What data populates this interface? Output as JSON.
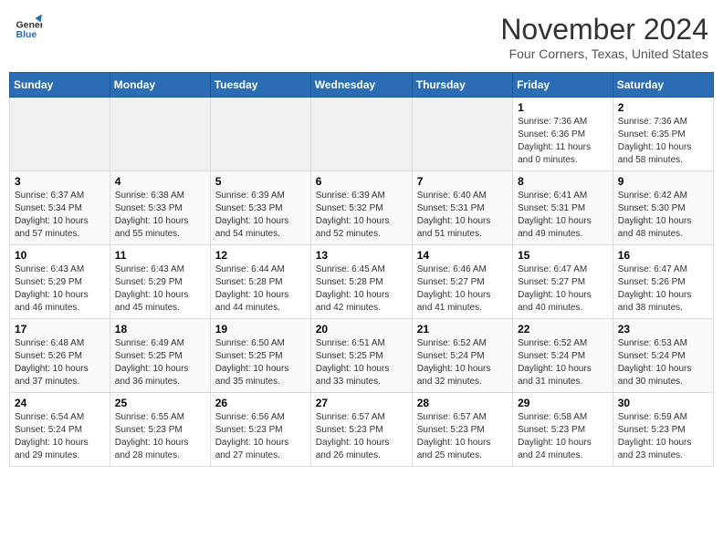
{
  "header": {
    "logo_general": "General",
    "logo_blue": "Blue",
    "month": "November 2024",
    "location": "Four Corners, Texas, United States"
  },
  "weekdays": [
    "Sunday",
    "Monday",
    "Tuesday",
    "Wednesday",
    "Thursday",
    "Friday",
    "Saturday"
  ],
  "weeks": [
    [
      {
        "day": "",
        "info": ""
      },
      {
        "day": "",
        "info": ""
      },
      {
        "day": "",
        "info": ""
      },
      {
        "day": "",
        "info": ""
      },
      {
        "day": "",
        "info": ""
      },
      {
        "day": "1",
        "info": "Sunrise: 7:36 AM\nSunset: 6:36 PM\nDaylight: 11 hours\nand 0 minutes."
      },
      {
        "day": "2",
        "info": "Sunrise: 7:36 AM\nSunset: 6:35 PM\nDaylight: 10 hours\nand 58 minutes."
      }
    ],
    [
      {
        "day": "3",
        "info": "Sunrise: 6:37 AM\nSunset: 5:34 PM\nDaylight: 10 hours\nand 57 minutes."
      },
      {
        "day": "4",
        "info": "Sunrise: 6:38 AM\nSunset: 5:33 PM\nDaylight: 10 hours\nand 55 minutes."
      },
      {
        "day": "5",
        "info": "Sunrise: 6:39 AM\nSunset: 5:33 PM\nDaylight: 10 hours\nand 54 minutes."
      },
      {
        "day": "6",
        "info": "Sunrise: 6:39 AM\nSunset: 5:32 PM\nDaylight: 10 hours\nand 52 minutes."
      },
      {
        "day": "7",
        "info": "Sunrise: 6:40 AM\nSunset: 5:31 PM\nDaylight: 10 hours\nand 51 minutes."
      },
      {
        "day": "8",
        "info": "Sunrise: 6:41 AM\nSunset: 5:31 PM\nDaylight: 10 hours\nand 49 minutes."
      },
      {
        "day": "9",
        "info": "Sunrise: 6:42 AM\nSunset: 5:30 PM\nDaylight: 10 hours\nand 48 minutes."
      }
    ],
    [
      {
        "day": "10",
        "info": "Sunrise: 6:43 AM\nSunset: 5:29 PM\nDaylight: 10 hours\nand 46 minutes."
      },
      {
        "day": "11",
        "info": "Sunrise: 6:43 AM\nSunset: 5:29 PM\nDaylight: 10 hours\nand 45 minutes."
      },
      {
        "day": "12",
        "info": "Sunrise: 6:44 AM\nSunset: 5:28 PM\nDaylight: 10 hours\nand 44 minutes."
      },
      {
        "day": "13",
        "info": "Sunrise: 6:45 AM\nSunset: 5:28 PM\nDaylight: 10 hours\nand 42 minutes."
      },
      {
        "day": "14",
        "info": "Sunrise: 6:46 AM\nSunset: 5:27 PM\nDaylight: 10 hours\nand 41 minutes."
      },
      {
        "day": "15",
        "info": "Sunrise: 6:47 AM\nSunset: 5:27 PM\nDaylight: 10 hours\nand 40 minutes."
      },
      {
        "day": "16",
        "info": "Sunrise: 6:47 AM\nSunset: 5:26 PM\nDaylight: 10 hours\nand 38 minutes."
      }
    ],
    [
      {
        "day": "17",
        "info": "Sunrise: 6:48 AM\nSunset: 5:26 PM\nDaylight: 10 hours\nand 37 minutes."
      },
      {
        "day": "18",
        "info": "Sunrise: 6:49 AM\nSunset: 5:25 PM\nDaylight: 10 hours\nand 36 minutes."
      },
      {
        "day": "19",
        "info": "Sunrise: 6:50 AM\nSunset: 5:25 PM\nDaylight: 10 hours\nand 35 minutes."
      },
      {
        "day": "20",
        "info": "Sunrise: 6:51 AM\nSunset: 5:25 PM\nDaylight: 10 hours\nand 33 minutes."
      },
      {
        "day": "21",
        "info": "Sunrise: 6:52 AM\nSunset: 5:24 PM\nDaylight: 10 hours\nand 32 minutes."
      },
      {
        "day": "22",
        "info": "Sunrise: 6:52 AM\nSunset: 5:24 PM\nDaylight: 10 hours\nand 31 minutes."
      },
      {
        "day": "23",
        "info": "Sunrise: 6:53 AM\nSunset: 5:24 PM\nDaylight: 10 hours\nand 30 minutes."
      }
    ],
    [
      {
        "day": "24",
        "info": "Sunrise: 6:54 AM\nSunset: 5:24 PM\nDaylight: 10 hours\nand 29 minutes."
      },
      {
        "day": "25",
        "info": "Sunrise: 6:55 AM\nSunset: 5:23 PM\nDaylight: 10 hours\nand 28 minutes."
      },
      {
        "day": "26",
        "info": "Sunrise: 6:56 AM\nSunset: 5:23 PM\nDaylight: 10 hours\nand 27 minutes."
      },
      {
        "day": "27",
        "info": "Sunrise: 6:57 AM\nSunset: 5:23 PM\nDaylight: 10 hours\nand 26 minutes."
      },
      {
        "day": "28",
        "info": "Sunrise: 6:57 AM\nSunset: 5:23 PM\nDaylight: 10 hours\nand 25 minutes."
      },
      {
        "day": "29",
        "info": "Sunrise: 6:58 AM\nSunset: 5:23 PM\nDaylight: 10 hours\nand 24 minutes."
      },
      {
        "day": "30",
        "info": "Sunrise: 6:59 AM\nSunset: 5:23 PM\nDaylight: 10 hours\nand 23 minutes."
      }
    ]
  ]
}
